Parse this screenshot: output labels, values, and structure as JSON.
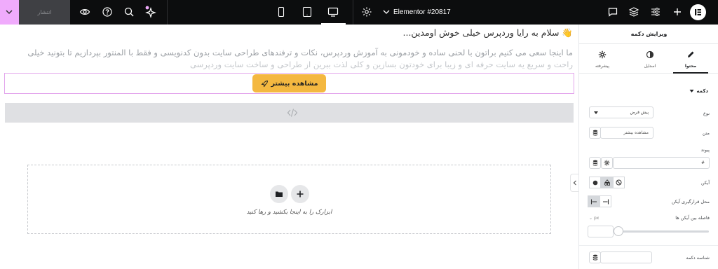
{
  "topbar": {
    "publish_label": "انتشار",
    "page_title": "Elementor #20817",
    "icons": [
      "chevron-down-icon",
      "eye-icon",
      "help-icon",
      "search-icon",
      "sparkle-icon",
      "mobile-icon",
      "tablet-icon",
      "desktop-icon",
      "settings-icon",
      "chat-icon",
      "layers-icon",
      "sliders-icon",
      "plus-icon",
      "elementor-logo"
    ]
  },
  "canvas": {
    "heading": "👋 سلام به رایا وردپرس خیلی خوش اومدین...",
    "paragraph_line1": "ما اینجا سعی می کنیم براتون با لحنی ساده و خودمونی به آموزش وردپرس، نکات و ترفندهای طراحی سایت بدون کدنویسی و فقط با المنتور بپردازیم تا بتونید خیلی",
    "paragraph_line2": "راحت و سریع یه سایت حرفه ای و زیبا برای خودتون بسازین و کلی لذت ببرین از طراحی و ساخت سایت وردپرسی",
    "button_label": "مشاهده بیشتر",
    "drop_text": "ابزارک را به اینجا بکشید و رها کنید"
  },
  "panel": {
    "title": "ویرایش دکمه",
    "tabs": [
      "محتوا",
      "استایل",
      "پیشرفته"
    ],
    "section_title": "دکمه",
    "type_label": "نوع",
    "type_value": "پیش فرض",
    "text_label": "متن",
    "text_value": "مشاهده بیشتر",
    "link_label": "پیوند",
    "link_value": "#",
    "icon_label": "آیکن",
    "icon_position_label": "محل قرارگیری آیکن",
    "icon_spacing_label": "فاصله بین آیکن ها",
    "unit": "px",
    "button_id_label": "شناسه دکمه"
  },
  "colors": {
    "topbar_bg": "#0c0d0e",
    "accent_pink": "#f0abfc",
    "button_orange": "#f4b840"
  }
}
